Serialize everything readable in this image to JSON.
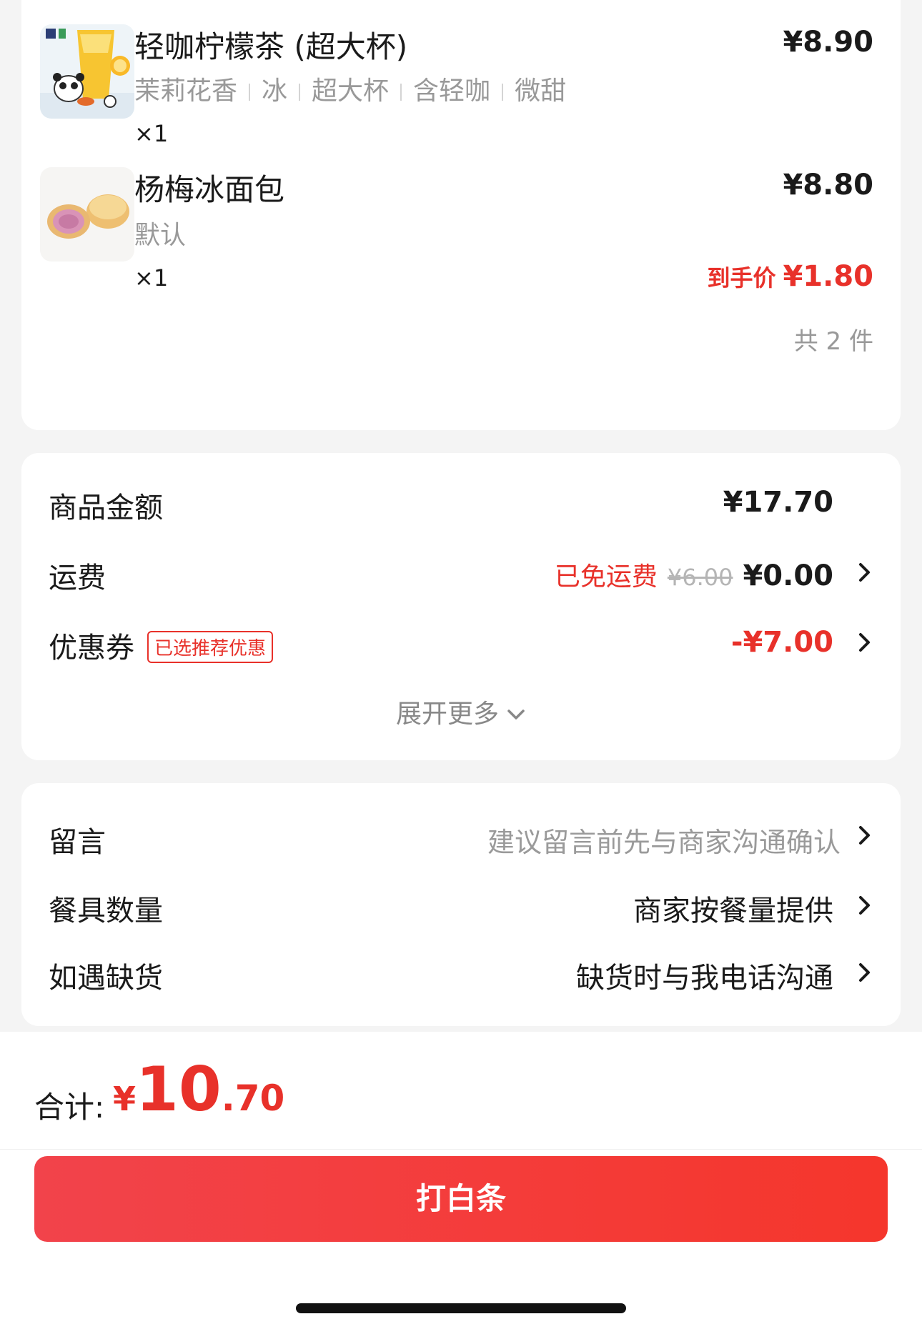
{
  "items": [
    {
      "name": "轻咖柠檬茶 (超大杯)",
      "price": "¥8.90",
      "options": [
        "茉莉花香",
        "冰",
        "超大杯",
        "含轻咖",
        "微甜"
      ],
      "quantity": "×1"
    },
    {
      "name": "杨梅冰面包",
      "price": "¥8.80",
      "options": [
        "默认"
      ],
      "quantity": "×1",
      "deal_label": "到手价",
      "deal_price": "¥1.80"
    }
  ],
  "item_count": "共 2 件",
  "fees": {
    "goods_label": "商品金额",
    "goods_value": "¥17.70",
    "shipping_label": "运费",
    "shipping_free": "已免运费",
    "shipping_original": "¥6.00",
    "shipping_value": "¥0.00",
    "coupon_label": "优惠券",
    "coupon_tag": "已选推荐优惠",
    "coupon_value": "-¥7.00",
    "expand_label": "展开更多"
  },
  "notes": {
    "message_label": "留言",
    "message_placeholder": "建议留言前先与商家沟通确认",
    "utensils_label": "餐具数量",
    "utensils_value": "商家按餐量提供",
    "stockout_label": "如遇缺货",
    "stockout_value": "缺货时与我电话沟通"
  },
  "footer": {
    "total_label": "合计:",
    "total_currency": "¥",
    "total_integer": "10",
    "total_decimal": ".70",
    "pay_button": "打白条"
  },
  "colors": {
    "accent_red": "#e8312a",
    "button_gradient_start": "#f2434b",
    "button_gradient_end": "#f5362c"
  },
  "icons": [
    "chevron-right-icon",
    "chevron-down-icon"
  ]
}
